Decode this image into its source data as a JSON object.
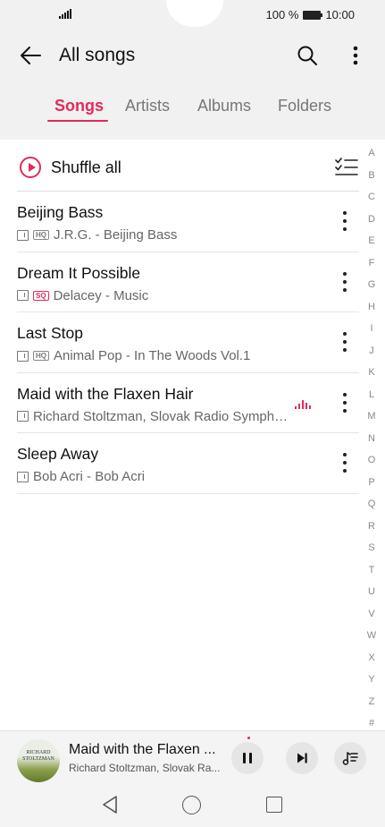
{
  "status": {
    "battery_text": "100 %",
    "time": "10:00"
  },
  "header": {
    "title": "All songs"
  },
  "tabs": [
    {
      "label": "Songs",
      "active": true
    },
    {
      "label": "Artists",
      "active": false
    },
    {
      "label": "Albums",
      "active": false
    },
    {
      "label": "Folders",
      "active": false
    }
  ],
  "shuffle": {
    "label": "Shuffle all"
  },
  "songs": [
    {
      "title": "Beijing Bass",
      "quality": "HQ",
      "subtitle": "J.R.G. - Beijing Bass",
      "playing": false
    },
    {
      "title": "Dream It Possible",
      "quality": "SQ",
      "subtitle": "Delacey - Music",
      "playing": false
    },
    {
      "title": "Last Stop",
      "quality": "HQ",
      "subtitle": "Animal Pop - In The Woods Vol.1",
      "playing": false
    },
    {
      "title": "Maid with the Flaxen Hair",
      "quality": "",
      "subtitle": "Richard Stoltzman, Slovak Radio Symph…",
      "playing": true
    },
    {
      "title": "Sleep Away",
      "quality": "",
      "subtitle": "Bob Acri - Bob Acri",
      "playing": false
    }
  ],
  "alpha_index": [
    "A",
    "B",
    "C",
    "D",
    "E",
    "F",
    "G",
    "H",
    "I",
    "J",
    "K",
    "L",
    "M",
    "N",
    "O",
    "P",
    "Q",
    "R",
    "S",
    "T",
    "U",
    "V",
    "W",
    "X",
    "Y",
    "Z",
    "#"
  ],
  "now_playing": {
    "title": "Maid with the Flaxen ...",
    "artist": "Richard Stoltzman, Slovak Ra...",
    "art_text_line1": "RICHARD",
    "art_text_line2": "STOLTZMAN"
  },
  "colors": {
    "accent": "#e4295a",
    "background": "#f1f1f1",
    "list_background": "#ffffff"
  }
}
